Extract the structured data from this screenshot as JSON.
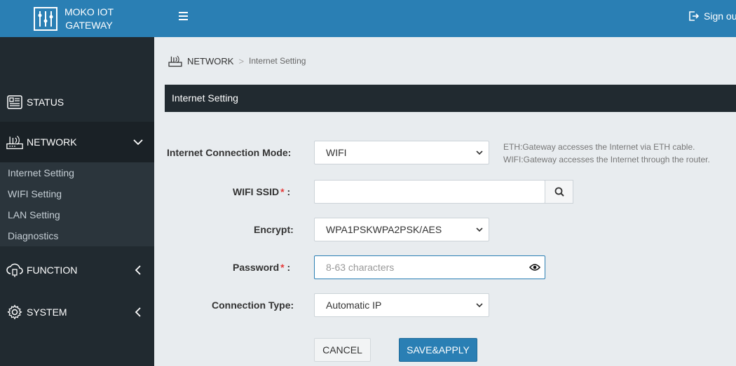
{
  "brand": {
    "line1": "MOKO IOT",
    "line2": "GATEWAY"
  },
  "topbar": {
    "signout_label": "Sign ou"
  },
  "sidebar": {
    "status_label": "STATUS",
    "network_label": "NETWORK",
    "network_submenu": [
      "Internet Setting",
      "WIFI Setting",
      "LAN Setting",
      "Diagnostics"
    ],
    "function_label": "FUNCTION",
    "system_label": "SYSTEM"
  },
  "breadcrumb": {
    "parent": "NETWORK",
    "separator": ">",
    "current": "Internet Setting"
  },
  "section_title": "Internet Setting",
  "form": {
    "mode_label": "Internet Connection Mode:",
    "mode_value": "WIFI",
    "mode_hint_1": "ETH:Gateway accesses the Internet via ETH cable.",
    "mode_hint_2": "WIFI:Gateway accesses the Internet through the router.",
    "ssid_label": "WIFI SSID",
    "ssid_value": "",
    "required_mark": "*",
    "colon": ":",
    "encrypt_label": "Encrypt:",
    "encrypt_value": "WPA1PSKWPA2PSK/AES",
    "password_label": "Password",
    "password_placeholder": "8-63 characters",
    "conn_type_label": "Connection Type:",
    "conn_type_value": "Automatic IP"
  },
  "buttons": {
    "cancel": "CANCEL",
    "save": "SAVE&APPLY"
  },
  "colors": {
    "primary": "#2a7fb4",
    "sidebar": "#212a30",
    "required": "#e53a3a"
  }
}
